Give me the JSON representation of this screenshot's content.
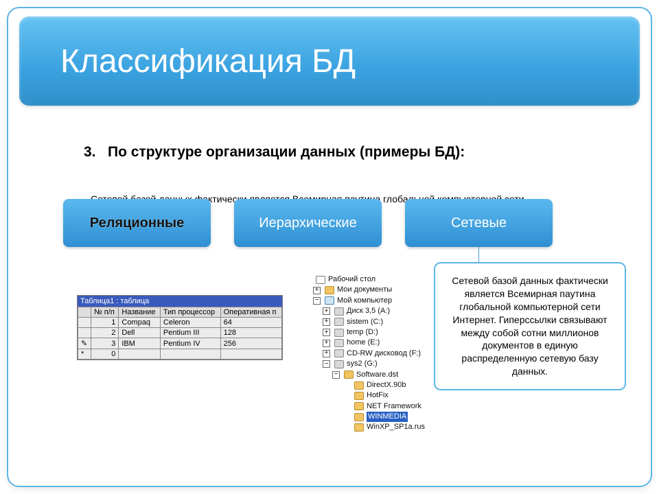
{
  "slide": {
    "title": "Классификация БД",
    "subtitle_number": "3.",
    "subtitle": "По структуре организации данных (примеры БД):",
    "overlap_text": "Сетевой базой данных фактически является Всемирная паутина глобальной компьютерной сети",
    "pills": {
      "relational": "Реляционные",
      "hierarchical": "Иерархические",
      "network": "Сетевые"
    }
  },
  "relational_example": {
    "titlebar": "Таблица1 : таблица",
    "headers": [
      "№ п/п",
      "Название",
      "Тип процессор",
      "Оперативная п"
    ],
    "rows": [
      [
        "1",
        "Compaq",
        "Celeron",
        "64"
      ],
      [
        "2",
        "Dell",
        "Pentium III",
        "128"
      ],
      [
        "3",
        "IBM",
        "Pentium IV",
        "256"
      ]
    ],
    "footer_zero": "0"
  },
  "hier_example": {
    "items": [
      {
        "indent": 0,
        "pm": "",
        "icon": "doc",
        "label": "Рабочий стол"
      },
      {
        "indent": 1,
        "pm": "+",
        "icon": "folder",
        "label": "Мои документы"
      },
      {
        "indent": 1,
        "pm": "−",
        "icon": "comp",
        "label": "Мой компьютер"
      },
      {
        "indent": 2,
        "pm": "+",
        "icon": "drive",
        "label": "Диск 3,5 (A:)"
      },
      {
        "indent": 2,
        "pm": "+",
        "icon": "drive",
        "label": "sistem (C:)"
      },
      {
        "indent": 2,
        "pm": "+",
        "icon": "drive",
        "label": "temp (D:)"
      },
      {
        "indent": 2,
        "pm": "+",
        "icon": "drive",
        "label": "home (E:)"
      },
      {
        "indent": 2,
        "pm": "+",
        "icon": "drive",
        "label": "CD-RW дисковод (F:)"
      },
      {
        "indent": 2,
        "pm": "−",
        "icon": "drive",
        "label": "sys2 (G:)"
      },
      {
        "indent": 3,
        "pm": "−",
        "icon": "folder",
        "label": "Software.dst"
      },
      {
        "indent": 4,
        "pm": "",
        "icon": "folder",
        "label": "DirectX.90b"
      },
      {
        "indent": 4,
        "pm": "",
        "icon": "folder",
        "label": "HotFix"
      },
      {
        "indent": 4,
        "pm": "",
        "icon": "folder",
        "label": "NET Framework"
      },
      {
        "indent": 4,
        "pm": "",
        "icon": "folder",
        "label": "WINMEDIA",
        "selected": true
      },
      {
        "indent": 4,
        "pm": "",
        "icon": "folder",
        "label": "WinXP_SP1a.rus"
      }
    ]
  },
  "network_example": {
    "text": "Сетевой базой данных фактически является Всемирная паутина глобальной компьютерной сети Интернет. Гиперссылки связывают между собой сотни миллионов документов в единую распределенную сетевую базу данных."
  }
}
